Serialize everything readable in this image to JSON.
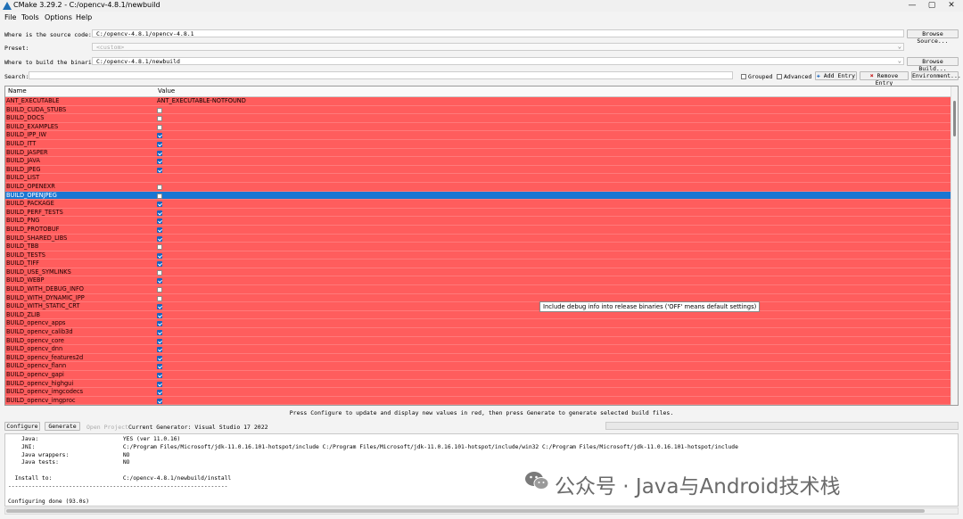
{
  "window": {
    "title": "CMake 3.29.2 - C:/opencv-4.8.1/newbuild",
    "minimize_glyph": "—",
    "maximize_glyph": "▢",
    "close_glyph": "✕"
  },
  "menu": [
    "File",
    "Tools",
    "Options",
    "Help"
  ],
  "paths": {
    "source_label": "Where is the source code:",
    "source_value": "C:/opencv-4.8.1/opencv-4.8.1",
    "browse_source": "Browse Source...",
    "preset_label": "Preset:",
    "preset_value": "<custom>",
    "build_label": "Where to build the binaries:",
    "build_value": "C:/opencv-4.8.1/newbuild",
    "browse_build": "Browse Build..."
  },
  "search": {
    "label": "Search:",
    "value": "",
    "grouped": "Grouped",
    "advanced": "Advanced",
    "add_entry": "Add Entry",
    "remove_entry": "Remove Entry",
    "environment": "Environment..."
  },
  "table": {
    "col_name": "Name",
    "col_value": "Value",
    "rows": [
      {
        "name": "ANT_EXECUTABLE",
        "text": "ANT_EXECUTABLE-NOTFOUND"
      },
      {
        "name": "BUILD_CUDA_STUBS",
        "checked": false
      },
      {
        "name": "BUILD_DOCS",
        "checked": false
      },
      {
        "name": "BUILD_EXAMPLES",
        "checked": false
      },
      {
        "name": "BUILD_IPP_IW",
        "checked": true
      },
      {
        "name": "BUILD_ITT",
        "checked": true
      },
      {
        "name": "BUILD_JASPER",
        "checked": true
      },
      {
        "name": "BUILD_JAVA",
        "checked": true
      },
      {
        "name": "BUILD_JPEG",
        "checked": true
      },
      {
        "name": "BUILD_LIST",
        "text": ""
      },
      {
        "name": "BUILD_OPENEXR",
        "checked": false
      },
      {
        "name": "BUILD_OPENJPEG",
        "checked": false,
        "selected": true
      },
      {
        "name": "BUILD_PACKAGE",
        "checked": true
      },
      {
        "name": "BUILD_PERF_TESTS",
        "checked": true
      },
      {
        "name": "BUILD_PNG",
        "checked": true
      },
      {
        "name": "BUILD_PROTOBUF",
        "checked": true
      },
      {
        "name": "BUILD_SHARED_LIBS",
        "checked": true
      },
      {
        "name": "BUILD_TBB",
        "checked": false
      },
      {
        "name": "BUILD_TESTS",
        "checked": true
      },
      {
        "name": "BUILD_TIFF",
        "checked": true
      },
      {
        "name": "BUILD_USE_SYMLINKS",
        "checked": false
      },
      {
        "name": "BUILD_WEBP",
        "checked": true
      },
      {
        "name": "BUILD_WITH_DEBUG_INFO",
        "checked": false
      },
      {
        "name": "BUILD_WITH_DYNAMIC_IPP",
        "checked": false
      },
      {
        "name": "BUILD_WITH_STATIC_CRT",
        "checked": true
      },
      {
        "name": "BUILD_ZLIB",
        "checked": true
      },
      {
        "name": "BUILD_opencv_apps",
        "checked": true
      },
      {
        "name": "BUILD_opencv_calib3d",
        "checked": true
      },
      {
        "name": "BUILD_opencv_core",
        "checked": true
      },
      {
        "name": "BUILD_opencv_dnn",
        "checked": true
      },
      {
        "name": "BUILD_opencv_features2d",
        "checked": true
      },
      {
        "name": "BUILD_opencv_flann",
        "checked": true
      },
      {
        "name": "BUILD_opencv_gapi",
        "checked": true
      },
      {
        "name": "BUILD_opencv_highgui",
        "checked": true
      },
      {
        "name": "BUILD_opencv_imgcodecs",
        "checked": true
      },
      {
        "name": "BUILD_opencv_imgproc",
        "checked": true
      }
    ],
    "tooltip": "Include debug info into release binaries ('OFF' means default settings)"
  },
  "hint": "Press Configure to update and display new values in red, then press Generate to generate selected build files.",
  "actions": {
    "configure": "Configure",
    "generate": "Generate",
    "open_project": "Open Project",
    "current_generator": "Current Generator: Visual Studio 17 2022"
  },
  "output": [
    "    Java:                         YES (ver 11.0.16)",
    "    JNI:                          C:/Program Files/Microsoft/jdk-11.0.16.101-hotspot/include C:/Program Files/Microsoft/jdk-11.0.16.101-hotspot/include/win32 C:/Program Files/Microsoft/jdk-11.0.16.101-hotspot/include",
    "    Java wrappers:                NO",
    "    Java tests:                   NO",
    "",
    "  Install to:                     C:/opencv-4.8.1/newbuild/install",
    "-----------------------------------------------------------------",
    "",
    "Configuring done (93.0s)"
  ],
  "watermark": "公众号 · Java与Android技术栈"
}
